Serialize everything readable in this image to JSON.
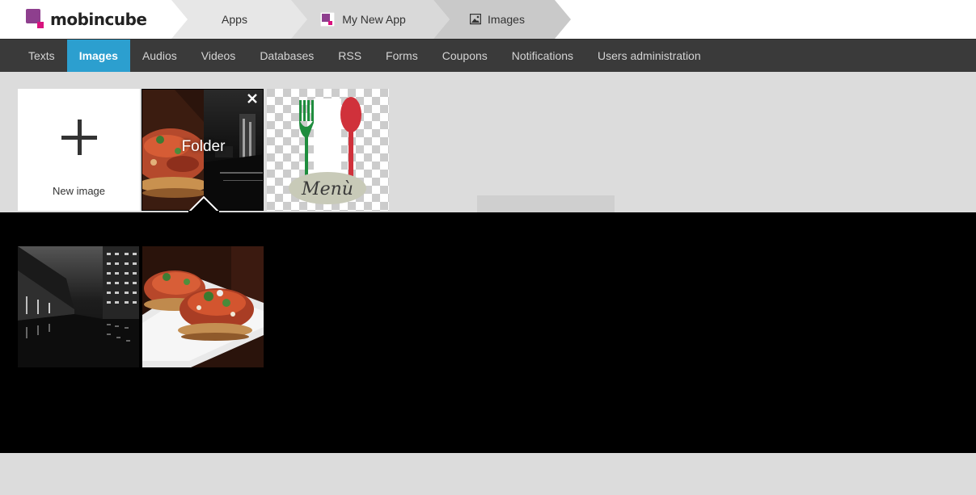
{
  "header": {
    "logo_text": "mobincube",
    "breadcrumbs": [
      {
        "label": "Apps"
      },
      {
        "label": "My New App",
        "icon": "app-icon"
      },
      {
        "label": "Images",
        "icon": "image-icon"
      }
    ]
  },
  "nav": {
    "items": [
      {
        "label": "Texts"
      },
      {
        "label": "Images",
        "active": true
      },
      {
        "label": "Audios"
      },
      {
        "label": "Videos"
      },
      {
        "label": "Databases"
      },
      {
        "label": "RSS"
      },
      {
        "label": "Forms"
      },
      {
        "label": "Coupons"
      },
      {
        "label": "Notifications"
      },
      {
        "label": "Users administration"
      }
    ]
  },
  "tiles": {
    "new_image_label": "New image",
    "folder_label": "Folder",
    "menu_image_text": "Menù"
  },
  "colors": {
    "accent": "#2c9fcf",
    "nav_bg": "#3a3a3a",
    "brand_purple": "#8e3f8e",
    "brand_pink": "#d8137e"
  }
}
